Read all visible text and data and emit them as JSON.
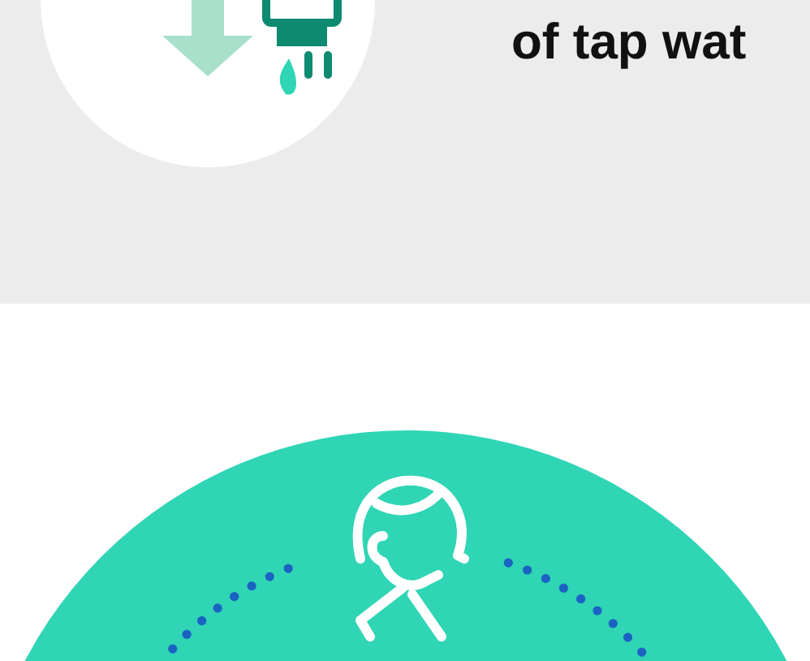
{
  "heading": {
    "text": "of tap wat"
  }
}
